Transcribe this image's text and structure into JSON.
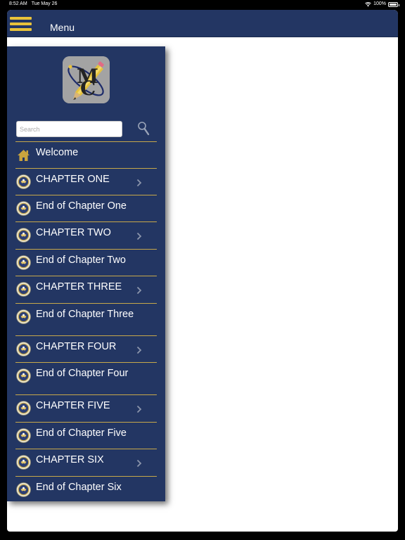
{
  "status_bar": {
    "time": "8:52 AM",
    "date": "Tue May 26",
    "battery": "100%"
  },
  "nav": {
    "title": "Menu"
  },
  "search": {
    "placeholder": "Search",
    "value": ""
  },
  "logo": {
    "letters": "MC"
  },
  "colors": {
    "navy": "#233663",
    "gold": "#c7a84a",
    "hamburger": "#e8c23a"
  },
  "menu": {
    "items": [
      {
        "label": "Welcome",
        "icon": "home-icon",
        "has_chevron": false
      },
      {
        "label": "CHAPTER ONE",
        "icon": "seal-icon",
        "has_chevron": true
      },
      {
        "label": "End of Chapter One",
        "icon": "seal-icon",
        "has_chevron": false
      },
      {
        "label": "CHAPTER TWO",
        "icon": "seal-icon",
        "has_chevron": true
      },
      {
        "label": "End of Chapter Two",
        "icon": "seal-icon",
        "has_chevron": false
      },
      {
        "label": "CHAPTER THREE",
        "icon": "seal-icon",
        "has_chevron": true
      },
      {
        "label": "End of Chapter Three",
        "icon": "seal-icon",
        "has_chevron": false
      },
      {
        "label": "CHAPTER FOUR",
        "icon": "seal-icon",
        "has_chevron": true
      },
      {
        "label": "End of Chapter Four",
        "icon": "seal-icon",
        "has_chevron": false
      },
      {
        "label": "CHAPTER FIVE",
        "icon": "seal-icon",
        "has_chevron": true
      },
      {
        "label": "End of Chapter Five",
        "icon": "seal-icon",
        "has_chevron": false
      },
      {
        "label": "CHAPTER SIX",
        "icon": "seal-icon",
        "has_chevron": true
      },
      {
        "label": "End of Chapter Six",
        "icon": "seal-icon",
        "has_chevron": false
      }
    ]
  }
}
